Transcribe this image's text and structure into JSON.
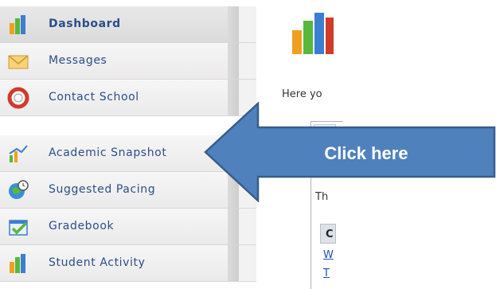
{
  "sidebar": {
    "items": [
      {
        "label": "Dashboard",
        "icon": "bar-chart-icon"
      },
      {
        "label": "Messages",
        "icon": "envelope-icon"
      },
      {
        "label": "Contact School",
        "icon": "lifebuoy-icon"
      },
      {
        "label": "Academic Snapshot",
        "icon": "snapshot-chart-icon"
      },
      {
        "label": "Suggested Pacing",
        "icon": "globe-clock-icon"
      },
      {
        "label": "Gradebook",
        "icon": "gradebook-check-icon"
      },
      {
        "label": "Student Activity",
        "icon": "bar-chart-icon"
      }
    ]
  },
  "main": {
    "intro_text": "Here yo",
    "panel_text": "Th",
    "table_header": "C",
    "links": [
      "W",
      "T"
    ]
  },
  "callout": {
    "label": "Click here",
    "color": "#4f81bd",
    "border_color": "#385d8a"
  },
  "colors": {
    "nav_text": "#2a4e8a",
    "accent_orange": "#f0a020",
    "accent_green": "#58b83a",
    "accent_blue": "#3a7fd0"
  }
}
